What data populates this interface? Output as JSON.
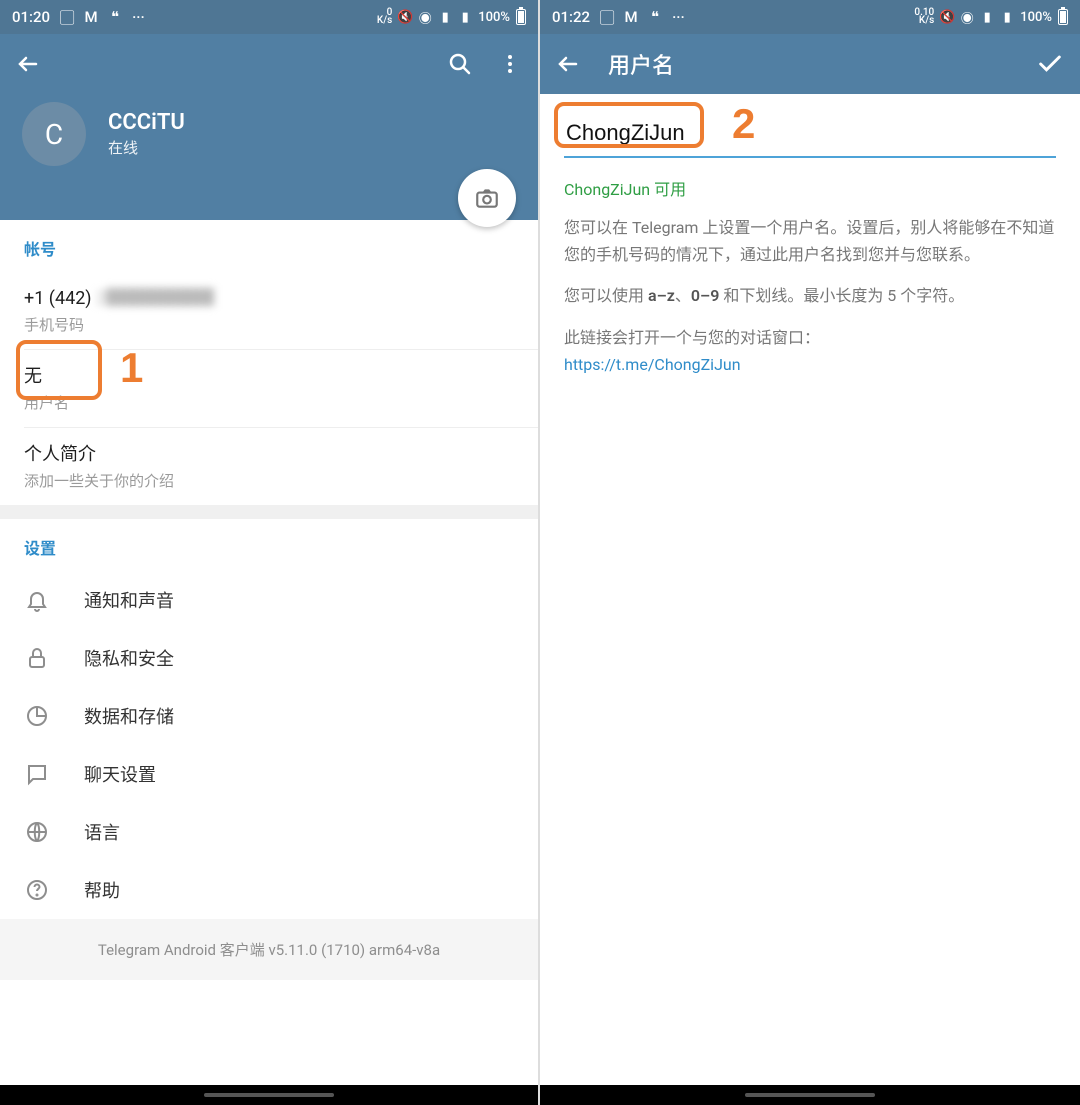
{
  "left": {
    "status": {
      "time": "01:20",
      "net": "0\nK/s",
      "battery": "100%"
    },
    "profile": {
      "initial": "C",
      "name": "CCCiTU",
      "status": "在线"
    },
    "account": {
      "section": "帐号",
      "phone_value": "+1 (442)",
      "phone_label": "手机号码",
      "username_value": "无",
      "username_label": "用户名",
      "bio_title": "个人简介",
      "bio_hint": "添加一些关于你的介绍"
    },
    "settings": {
      "section": "设置",
      "items": [
        "通知和声音",
        "隐私和安全",
        "数据和存储",
        "聊天设置",
        "语言",
        "帮助"
      ]
    },
    "version": "Telegram Android 客户端 v5.11.0 (1710) arm64-v8a",
    "callout_number": "1"
  },
  "right": {
    "status": {
      "time": "01:22",
      "net": "0.10\nK/s",
      "battery": "100%"
    },
    "title": "用户名",
    "input_value": "ChongZiJun",
    "available_text": "ChongZiJun 可用",
    "info1": "您可以在 Telegram 上设置一个用户名。设置后，别人将能够在不知道您的手机号码的情况下，通过此用户名找到您并与您联系。",
    "info2_plain": "您可以使用 ",
    "info2_b1": "a–z",
    "info2_mid": "、",
    "info2_b2": "0–9",
    "info2_tail": " 和下划线。最小长度为 5 个字符。",
    "info3": "此链接会打开一个与您的对话窗口：",
    "link": "https://t.me/ChongZiJun",
    "callout_number": "2"
  }
}
